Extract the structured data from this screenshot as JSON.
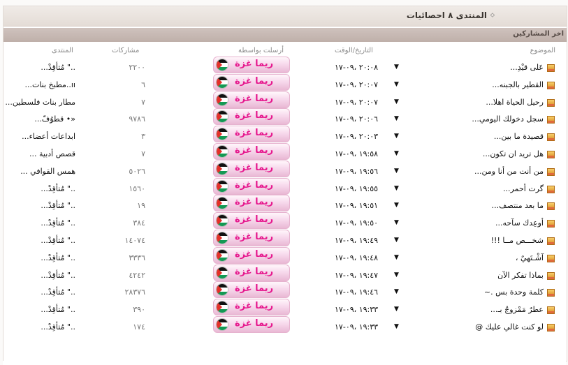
{
  "header": {
    "title": "المنتدى ٨ احصائيات",
    "collapse_icon": "chevron-down-icon"
  },
  "subheader": {
    "title": "اخر المشاركين"
  },
  "columns": {
    "topic": "الموضوع",
    "datetime": "التاريخ/الوقت",
    "poster": "أرسلت بواسطة",
    "posts": "مشاركات",
    "forum": "المنتدى"
  },
  "rows": [
    {
      "topic": "عَلى قيْدِ...",
      "date": "٢٠:٠٨ ،٠٩-١٧",
      "poster": "ريما غزة",
      "posts": "٢٢٠٠",
      "forum": "..\" مُتأقِدْ..."
    },
    {
      "topic": "القطير بالجبنه...",
      "date": "٢٠:٠٧ ،٠٩-١٧",
      "poster": "ريما غزة",
      "posts": "٦",
      "forum": "ıı..مطبخ بنات..."
    },
    {
      "topic": "رحيل الحياة اهلا...",
      "date": "٢٠:٠٧ ،٠٩-١٧",
      "poster": "ريما غزة",
      "posts": "٧",
      "forum": "مطار بنات فلسطين..."
    },
    {
      "topic": "سجل دخولك اليومي...",
      "date": "٢٠:٠٦ ،٠٩-١٧",
      "poster": "ريما غزة",
      "posts": "٩٧٨٦",
      "forum": "«• قطوُفّ..."
    },
    {
      "topic": "قصيدة ما بين...",
      "date": "٢٠:٠٣ ،٠٩-١٧",
      "poster": "ريما غزة",
      "posts": "٣",
      "forum": "ابداعات أعضاء..."
    },
    {
      "topic": "هل تريد ان تكون...",
      "date": "١٩:٥٨ ،٠٩-١٧",
      "poster": "ريما غزة",
      "posts": "٧",
      "forum": "قصص أدبية ..."
    },
    {
      "topic": "من أنت من أنا ومن...",
      "date": "١٩:٥٦ ،٠٩-١٧",
      "poster": "ريما غزة",
      "posts": "٥٠٢٦",
      "forum": "همس القوافي ..."
    },
    {
      "topic": "گرت أحمر...",
      "date": "١٩:٥٥ ،٠٩-١٧",
      "poster": "ريما غزة",
      "posts": "١٥٦٠",
      "forum": "..\" مُتأقِدْ..."
    },
    {
      "topic": "ما بعد منتصف...",
      "date": "١٩:٥١ ،٠٩-١٧",
      "poster": "ريما غزة",
      "posts": "١٩",
      "forum": "..\" مُتأقِدْ..."
    },
    {
      "topic": "أوعِدك سآحه...",
      "date": "١٩:٥٠ ،٠٩-١٧",
      "poster": "ريما غزة",
      "posts": "٣٨٤",
      "forum": "..\" مُتأقِدْ..."
    },
    {
      "topic": "شخـــص مــا !!!",
      "date": "١٩:٤٩ ،٠٩-١٧",
      "poster": "ريما غزة",
      "posts": "١٤٠٧٤",
      "forum": "..\" مُتأقِدْ..."
    },
    {
      "topic": "آشْـتَهيٌ ،",
      "date": "١٩:٤٨ ،٠٩-١٧",
      "poster": "ريما غزة",
      "posts": "٣٣٣٦",
      "forum": "..\" مُتأقِدْ..."
    },
    {
      "topic": "بماذا تفكر الآن",
      "date": "١٩:٤٧ ،٠٩-١٧",
      "poster": "ريما غزة",
      "posts": "٤٢٤٢",
      "forum": "..\" مُتأقِدْ..."
    },
    {
      "topic": "كلمة وحدة بس .~",
      "date": "١٩:٤٦ ،٠٩-١٧",
      "poster": "ريما غزة",
      "posts": "٢٨٣٧٦",
      "forum": "..\" مُتأقِدْ..."
    },
    {
      "topic": "عطرٌ مَمْزوجٌ بـ...",
      "date": "١٩:٣٣ ،٠٩-١٧",
      "poster": "ريما غزة",
      "posts": "٣٩٠",
      "forum": "..\" مُتأقِدْ..."
    },
    {
      "topic": "لو كنت غالي عليك @",
      "date": "١٩:٣٣ ،٠٩-١٧",
      "poster": "ريما غزة",
      "posts": "١٧٤",
      "forum": "..\" مُتأقِدْ..."
    }
  ]
}
